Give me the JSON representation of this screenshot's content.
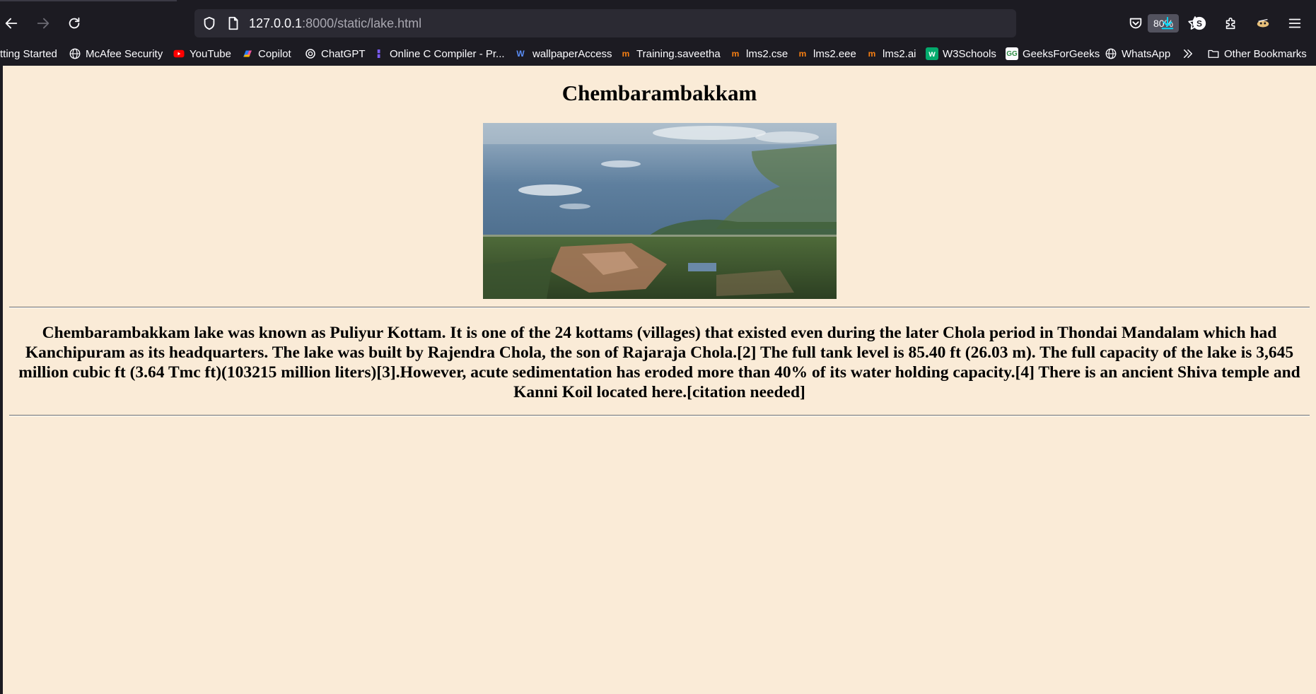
{
  "browser": {
    "url_host": "127.0.0.1",
    "url_path": ":8000/static/lake.html",
    "zoom": "80%",
    "bookmarks": [
      {
        "label": "tting Started",
        "icon": "none"
      },
      {
        "label": "McAfee Security",
        "icon": "globe-icon"
      },
      {
        "label": "YouTube",
        "icon": "youtube-icon"
      },
      {
        "label": "Copilot",
        "icon": "copilot-icon"
      },
      {
        "label": "ChatGPT",
        "icon": "chatgpt-icon"
      },
      {
        "label": "Online C Compiler - Pr...",
        "icon": "compiler-icon"
      },
      {
        "label": "wallpaperAccess",
        "icon": "wallpaperaccess-icon"
      },
      {
        "label": "Training.saveetha",
        "icon": "moodle-icon"
      },
      {
        "label": "lms2.cse",
        "icon": "moodle-icon"
      },
      {
        "label": "lms2.eee",
        "icon": "moodle-icon"
      },
      {
        "label": "lms2.ai",
        "icon": "moodle-icon"
      },
      {
        "label": "W3Schools",
        "icon": "w3schools-icon"
      },
      {
        "label": "GeeksForGeeks",
        "icon": "geeksforgeeks-icon"
      },
      {
        "label": "WhatsApp",
        "icon": "globe-icon"
      }
    ],
    "other_bookmarks": "Other Bookmarks",
    "colors": {
      "chrome_bg": "#1c1b22",
      "urlbar_bg": "#2b2a33",
      "download_accent": "#00ddff"
    }
  },
  "page": {
    "title": "Chembarambakkam",
    "description": "Chembarambakkam lake was known as Puliyur Kottam. It is one of the 24 kottams (villages) that existed even during the later Chola period in Thondai Mandalam which had Kanchipuram as its headquarters. The lake was built by Rajendra Chola, the son of Rajaraja Chola.[2] The full tank level is 85.40 ft (26.03 m). The full capacity of the lake is 3,645 million cubic ft (3.64 Tmc ft)(103215 million liters)[3].However, acute sedimentation has eroded more than 40% of its water holding capacity.[4] There is an ancient Shiva temple and Kanni Koil located here.[citation needed]",
    "background": "#faebd7"
  }
}
